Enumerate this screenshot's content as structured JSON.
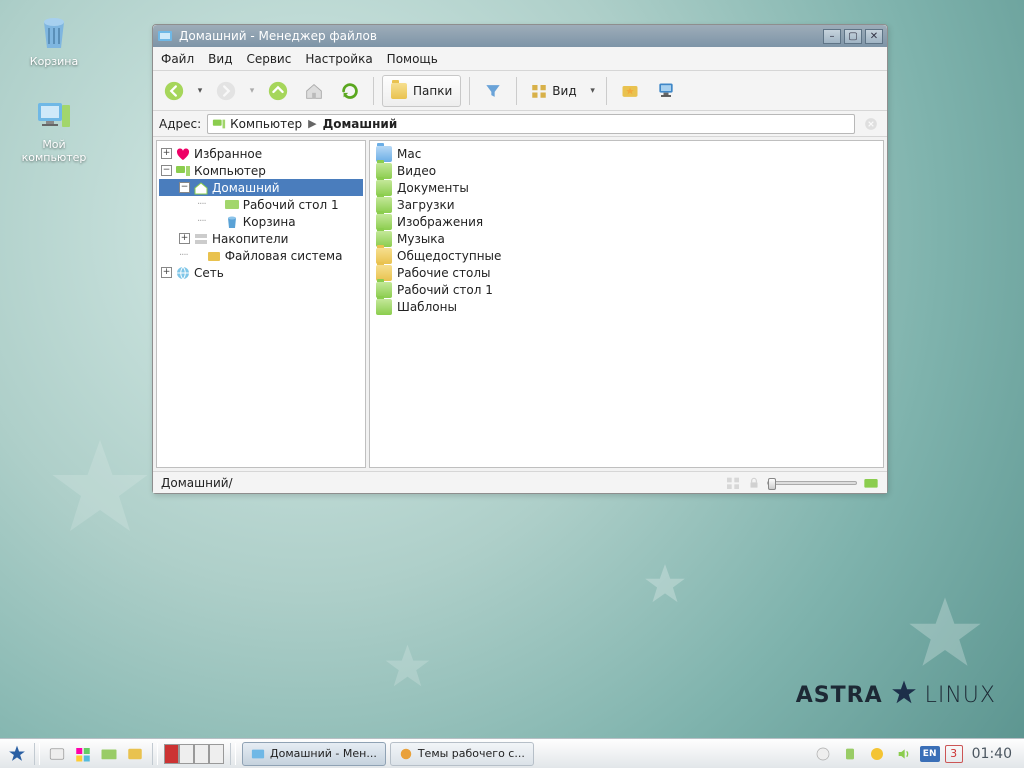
{
  "desktop": {
    "icons": [
      {
        "name": "trash",
        "label": "Корзина"
      },
      {
        "name": "computer",
        "label": "Мой компьютер"
      }
    ],
    "brand_left": "ASTRA",
    "brand_right": "LINUX"
  },
  "window": {
    "title": "Домашний - Менеджер файлов",
    "menus": [
      "Файл",
      "Вид",
      "Сервис",
      "Настройка",
      "Помощь"
    ],
    "toolbar": {
      "folders_label": "Папки",
      "view_label": "Вид"
    },
    "address": {
      "label": "Адрес:",
      "crumbs": [
        "Компьютер",
        "Домашний"
      ]
    },
    "tree": [
      {
        "indent": 0,
        "exp": "+",
        "icon": "fav",
        "label": "Избранное"
      },
      {
        "indent": 0,
        "exp": "-",
        "icon": "pc",
        "label": "Компьютер"
      },
      {
        "indent": 1,
        "exp": "-",
        "icon": "home",
        "label": "Домашний",
        "selected": true
      },
      {
        "indent": 2,
        "exp": " ",
        "icon": "desk",
        "label": "Рабочий стол 1"
      },
      {
        "indent": 2,
        "exp": " ",
        "icon": "trash",
        "label": "Корзина"
      },
      {
        "indent": 1,
        "exp": "+",
        "icon": "drives",
        "label": "Накопители"
      },
      {
        "indent": 1,
        "exp": " ",
        "icon": "fs",
        "label": "Файловая система"
      },
      {
        "indent": 0,
        "exp": "+",
        "icon": "net",
        "label": "Сеть"
      }
    ],
    "files": [
      {
        "icon": "folder-b",
        "label": "Mac"
      },
      {
        "icon": "folder-g",
        "label": "Видео"
      },
      {
        "icon": "folder-g",
        "label": "Документы"
      },
      {
        "icon": "folder-g",
        "label": "Загрузки"
      },
      {
        "icon": "folder-g",
        "label": "Изображения"
      },
      {
        "icon": "folder-g",
        "label": "Музыка"
      },
      {
        "icon": "folder",
        "label": "Общедоступные"
      },
      {
        "icon": "folder",
        "label": "Рабочие столы"
      },
      {
        "icon": "folder-g",
        "label": "Рабочий стол 1"
      },
      {
        "icon": "folder-g",
        "label": "Шаблоны"
      }
    ],
    "status_path": "Домашний/"
  },
  "taskbar": {
    "tasks": [
      {
        "label": "Домашний - Мен...",
        "active": true
      },
      {
        "label": "Темы рабочего с...",
        "active": false
      }
    ],
    "lang": "EN",
    "workspace": "3",
    "clock": "01:40"
  }
}
